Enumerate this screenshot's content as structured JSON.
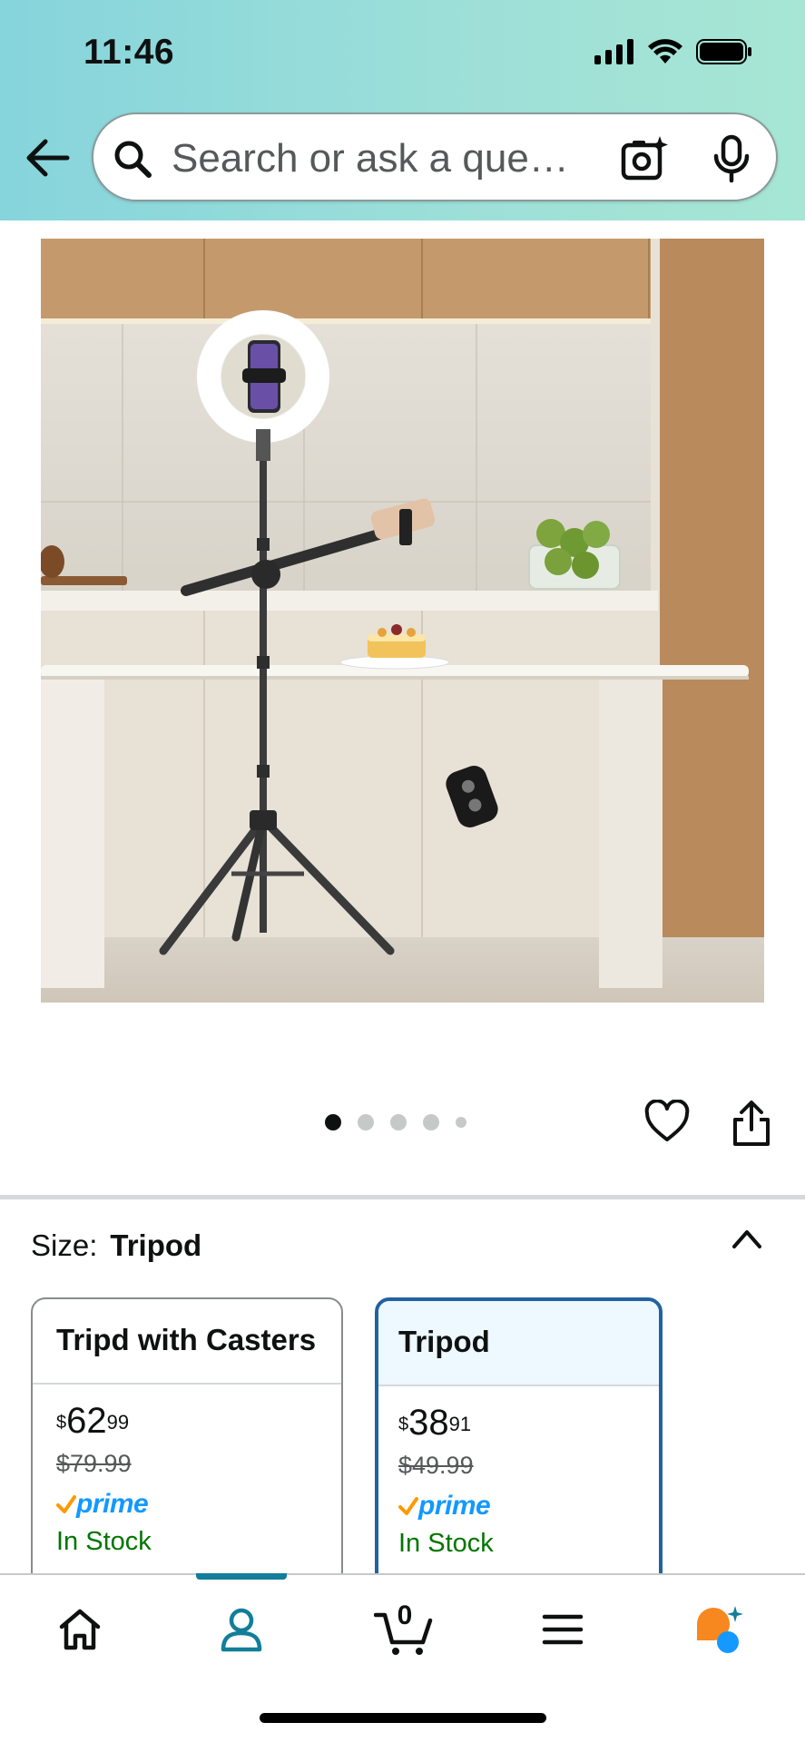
{
  "status_bar": {
    "time": "11:46"
  },
  "search": {
    "placeholder": "Search or ask a que…"
  },
  "product": {
    "image_alt": "Ring light tripod stand with phone holder in kitchen",
    "carousel": {
      "total": 5,
      "active": 1
    }
  },
  "size": {
    "label": "Size:",
    "selected": "Tripod",
    "options": [
      {
        "name": "Tripd with Casters",
        "price_symbol": "$",
        "price_whole": "62",
        "price_cents": "99",
        "list_price": "$79.99",
        "prime": "prime",
        "stock": "In Stock",
        "selected": false
      },
      {
        "name": "Tripod",
        "price_symbol": "$",
        "price_whole": "38",
        "price_cents": "91",
        "list_price": "$49.99",
        "prime": "prime",
        "stock": "In Stock",
        "selected": true
      }
    ]
  },
  "bottom_nav": {
    "items": [
      "home-icon",
      "account-icon",
      "cart-icon",
      "menu-icon",
      "rufus-icon"
    ],
    "cart_count": "0",
    "active": "account"
  },
  "colors": {
    "header_gradient_start": "#86d4dc",
    "header_gradient_end": "#a7e6d4",
    "selected_border": "#2162a1",
    "prime_blue": "#1399ff",
    "prime_check": "#ff9900",
    "in_stock": "#007600",
    "nav_active": "#127e99"
  }
}
